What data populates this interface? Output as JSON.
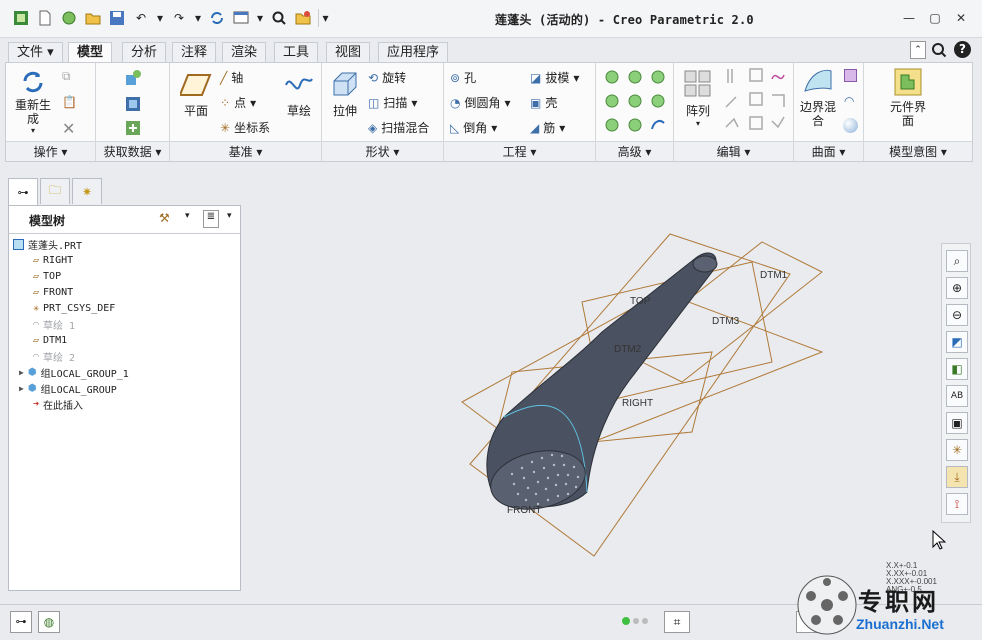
{
  "window": {
    "title": "莲蓬头 (活动的) - Creo Parametric 2.0"
  },
  "tabs": [
    "文件",
    "模型",
    "分析",
    "注释",
    "渲染",
    "工具",
    "视图",
    "应用程序"
  ],
  "ribbon": {
    "groups": [
      "操作",
      "获取数据",
      "基准",
      "形状",
      "工程",
      "高级",
      "编辑",
      "曲面",
      "模型意图"
    ],
    "operation": {
      "regenerate": "重新生成"
    },
    "datum": {
      "plane": "平面",
      "axis": "轴",
      "point": "点",
      "csys": "坐标系",
      "sketch": "草绘"
    },
    "shape": {
      "extrude": "拉伸",
      "revolve": "旋转",
      "sweep": "扫描",
      "swept_blend": "扫描混合"
    },
    "engineering": {
      "hole": "孔",
      "round": "倒圆角",
      "chamfer": "倒角",
      "draft": "拔模",
      "shell": "壳",
      "rib": "筋"
    },
    "edit": {
      "pattern": "阵列"
    },
    "surfaces": {
      "boundary_blend": "边界混合"
    },
    "model_intent": {
      "component_interface": "元件界面"
    }
  },
  "model_tree": {
    "title": "模型树",
    "items": [
      {
        "label": "莲蓬头.PRT",
        "icon": "part-icon",
        "dim": false
      },
      {
        "label": "RIGHT",
        "icon": "datum-plane-icon",
        "dim": false
      },
      {
        "label": "TOP",
        "icon": "datum-plane-icon",
        "dim": false
      },
      {
        "label": "FRONT",
        "icon": "datum-plane-icon",
        "dim": false
      },
      {
        "label": "PRT_CSYS_DEF",
        "icon": "csys-icon",
        "dim": false
      },
      {
        "label": "草绘 1",
        "icon": "sketch-icon",
        "dim": true
      },
      {
        "label": "DTM1",
        "icon": "datum-plane-icon",
        "dim": false
      },
      {
        "label": "草绘 2",
        "icon": "sketch-icon",
        "dim": true
      },
      {
        "label": "组LOCAL_GROUP_1",
        "icon": "group-icon",
        "dim": false
      },
      {
        "label": "组LOCAL_GROUP",
        "icon": "group-icon",
        "dim": false
      },
      {
        "label": "在此插入",
        "icon": "insert-arrow-icon",
        "dim": false
      }
    ]
  },
  "viewport_labels": {
    "dtm1": "DTM1",
    "dtm2": "DTM2",
    "dtm3": "DTM3",
    "top": "TOP",
    "right": "RIGHT",
    "front": "FRONT"
  },
  "tolerance": [
    "X.X+-0.1",
    "X.XX+-0.01",
    "X.XXX+-0.001",
    "ANG+-0.5"
  ],
  "watermark": {
    "title": "专职网",
    "url": "Zhuanzhi.Net"
  },
  "colors": {
    "accent": "#2a6cb8",
    "datum": "#b07a3a",
    "model": "#4a5160"
  }
}
